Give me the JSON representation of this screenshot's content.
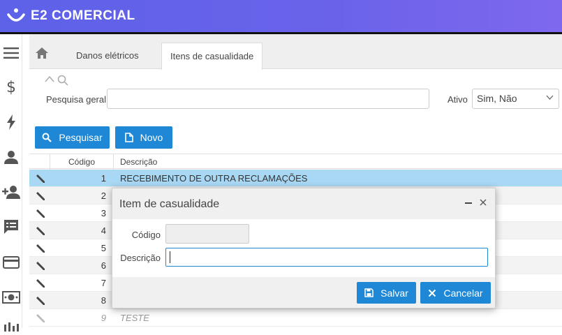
{
  "app": {
    "brand": "E2 COMERCIAL"
  },
  "tabs": [
    {
      "label": "Danos elétricos"
    },
    {
      "label": "Itens de casualidade",
      "active": true
    }
  ],
  "search": {
    "label": "Pesquisa geral",
    "value": "",
    "ativo_label": "Ativo",
    "ativo_value": "Sim, Não"
  },
  "actions": {
    "pesquisar": "Pesquisar",
    "novo": "Novo"
  },
  "grid": {
    "columns": [
      "Código",
      "Descrição"
    ],
    "rows": [
      {
        "code": "1",
        "desc": "RECEBIMENTO DE OUTRA RECLAMAÇÕES",
        "selected": true
      },
      {
        "code": "2",
        "desc": ""
      },
      {
        "code": "3",
        "desc": ""
      },
      {
        "code": "4",
        "desc": ""
      },
      {
        "code": "5",
        "desc": ""
      },
      {
        "code": "6",
        "desc": ""
      },
      {
        "code": "7",
        "desc": ""
      },
      {
        "code": "8",
        "desc": ""
      },
      {
        "code": "9",
        "desc": "TESTE",
        "inactive": true
      }
    ]
  },
  "modal": {
    "title": "Item de casualidade",
    "codigo_label": "Código",
    "codigo_value": "",
    "descricao_label": "Descrição",
    "descricao_value": "",
    "save": "Salvar",
    "cancel": "Cancelar"
  },
  "colors": {
    "primary": "#1e88d6",
    "selected_row": "#a9d8f4",
    "header_gradient_start": "#5d62e8",
    "header_gradient_end": "#7e68ee"
  }
}
